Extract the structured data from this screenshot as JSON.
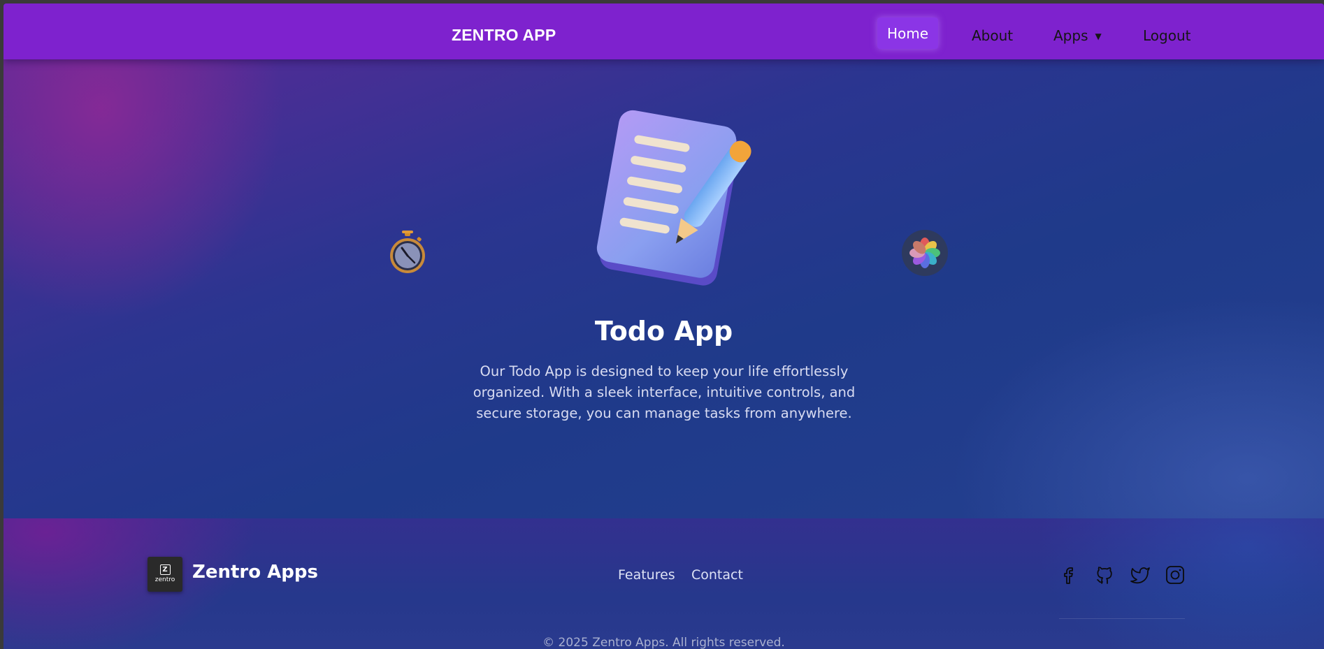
{
  "navbar": {
    "brand": "ZENTRO APP",
    "items": {
      "home": "Home",
      "about": "About",
      "apps": "Apps",
      "apps_caret": "▼",
      "logout": "Logout"
    }
  },
  "hero": {
    "title": "Todo App",
    "description": "Our Todo App is designed to keep your life effortlessly organized. With a sleek interface, intuitive controls, and secure storage, you can manage tasks from anywhere."
  },
  "footer": {
    "logo_text": "zentro",
    "logo_letter": "Z",
    "brand": "Zentro Apps",
    "links": {
      "features": "Features",
      "contact": "Contact"
    },
    "social_icons": [
      "facebook-icon",
      "github-icon",
      "twitter-icon",
      "instagram-icon"
    ],
    "copyright": "© 2025 Zentro Apps. All rights reserved."
  },
  "colors": {
    "navbar_bg": "#7e22ce",
    "active_nav_bg": "#8b35e6",
    "main_bg": "#1f3a8a"
  }
}
